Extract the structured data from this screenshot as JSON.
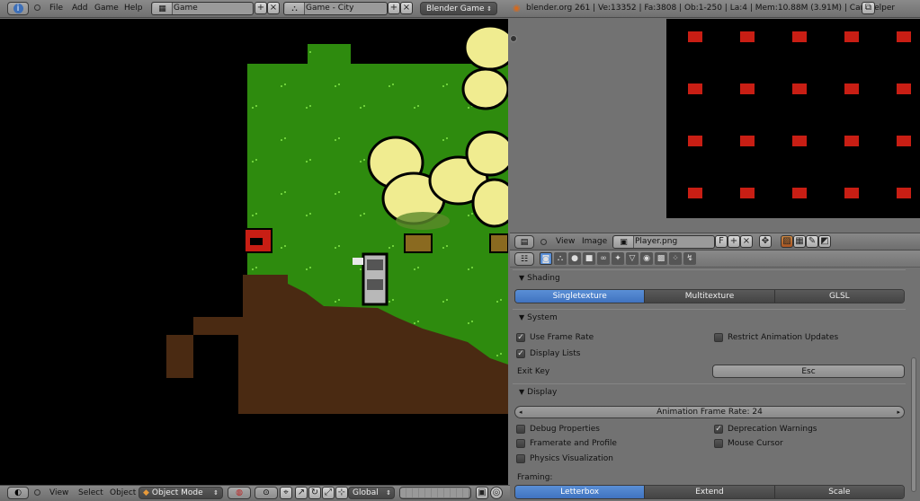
{
  "top": {
    "menus": [
      "File",
      "Add",
      "Game",
      "Help"
    ],
    "screen": "Game",
    "scene": "Game - City",
    "engine": "Blender Game",
    "stats": "blender.org 261 | Ve:13352 | Fa:3808 | Ob:1-250 | La:4 | Mem:10.88M (3.91M) | CamHelper"
  },
  "viewport_header": {
    "menus": [
      "View",
      "Select",
      "Object"
    ],
    "mode": "Object Mode",
    "orientation": "Global"
  },
  "image_editor": {
    "menus": [
      "View",
      "Image"
    ],
    "image_name": "Player.png",
    "fake_user": "F"
  },
  "shading": {
    "title": "Shading",
    "options": [
      "Singletexture",
      "Multitexture",
      "GLSL"
    ],
    "selected": 0
  },
  "system": {
    "title": "System",
    "use_frame_rate": "Use Frame Rate",
    "restrict_animation": "Restrict Animation Updates",
    "display_lists": "Display Lists",
    "exit_key_label": "Exit Key",
    "exit_key_value": "Esc"
  },
  "display": {
    "title": "Display",
    "frame_rate": "Animation Frame Rate: 24",
    "debug_properties": "Debug Properties",
    "deprecation_warnings": "Deprecation Warnings",
    "framerate_profile": "Framerate and Profile",
    "mouse_cursor": "Mouse Cursor",
    "physics_visualization": "Physics Visualization",
    "framing_label": "Framing:",
    "framing_options": [
      "Letterbox",
      "Extend",
      "Scale"
    ],
    "framing_selected": 0
  },
  "colors": {
    "accent": "#5a8fd6",
    "grass": "#2e8b0e",
    "dirt": "#4a2a12",
    "tree": "#f0ec90",
    "sprite_red": "#c81e14"
  }
}
